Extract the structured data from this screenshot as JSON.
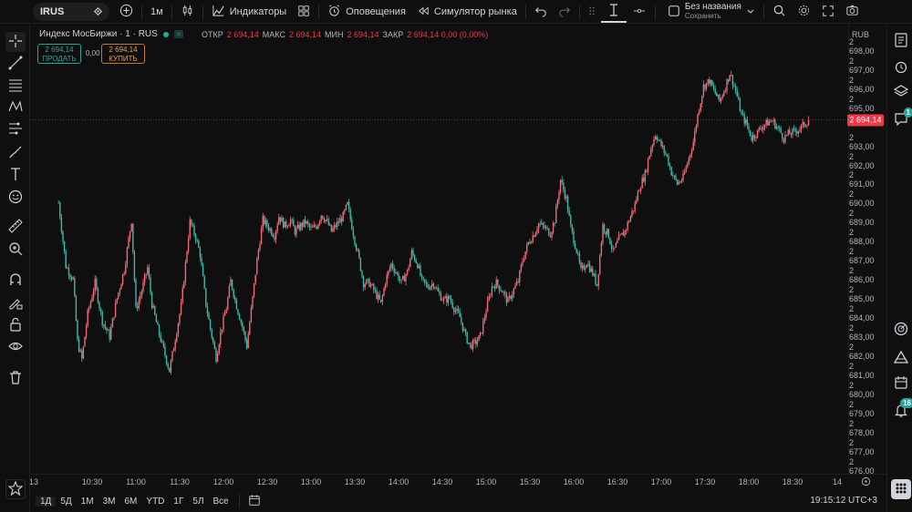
{
  "toolbar": {
    "symbol": "IRUS",
    "interval": "1м",
    "indicators": "Индикаторы",
    "alerts": "Оповещения",
    "replay": "Симулятор рынка",
    "layout_name": "Без названия",
    "layout_save": "Сохранить"
  },
  "legend": {
    "title": "Индекс МосБиржи · 1 · RUS",
    "ohlc": [
      {
        "k": "ОТКР",
        "v": "2 694,14"
      },
      {
        "k": "МАКС",
        "v": "2 694,14"
      },
      {
        "k": "МИН",
        "v": "2 694,14"
      },
      {
        "k": "ЗАКР",
        "v": "2 694,14 0,00 (0,00%)"
      }
    ],
    "sell_price": "2 694,14",
    "sell_label": "ПРОДАТЬ",
    "buy_price": "2 694,14",
    "buy_label": "КУПИТЬ",
    "spread": "0,00"
  },
  "price_axis": {
    "currency": "RUB",
    "last_price": "2 694,14",
    "ticks": [
      "2 698,00",
      "2 697,00",
      "2 696,00",
      "2 695,00",
      "2 693,00",
      "2 692,00",
      "2 691,00",
      "2 690,00",
      "2 689,00",
      "2 688,00",
      "2 687,00",
      "2 686,00",
      "2 685,00",
      "2 684,00",
      "2 683,00",
      "2 682,00",
      "2 681,00",
      "2 680,00",
      "2 679,00",
      "2 678,00",
      "2 677,00",
      "2 676,00"
    ]
  },
  "time_axis": {
    "ticks": [
      "13",
      "10:30",
      "11:00",
      "11:30",
      "12:00",
      "12:30",
      "13:00",
      "13:30",
      "14:00",
      "14:30",
      "15:00",
      "15:30",
      "16:00",
      "16:30",
      "17:00",
      "17:30",
      "18:00",
      "18:30",
      "14"
    ]
  },
  "bottom": {
    "ranges": [
      "1Д",
      "5Д",
      "1М",
      "3М",
      "6М",
      "YTD",
      "1Г",
      "5Л",
      "Все"
    ],
    "active_range": "1Д",
    "clock": "19:15:12 UTC+3"
  },
  "badges": {
    "chat": "1",
    "notifications": "16"
  },
  "colors": {
    "up": "#f06a78",
    "down": "#3fb8a8",
    "background": "#0f0f0f",
    "price_label": "#f23645"
  },
  "chart_data": {
    "type": "candlestick",
    "x_start": "10:07",
    "x_end": "18:53",
    "interval": "1m",
    "ylim": [
      2675.8,
      2698.8
    ],
    "last": 2694.14,
    "close_path": [
      [
        "10:07",
        2689.8
      ],
      [
        "10:12",
        2686.5
      ],
      [
        "10:17",
        2685.8
      ],
      [
        "10:20",
        2682.5
      ],
      [
        "10:23",
        2681.6
      ],
      [
        "10:27",
        2684.0
      ],
      [
        "10:32",
        2685.6
      ],
      [
        "10:37",
        2683.6
      ],
      [
        "10:42",
        2682.8
      ],
      [
        "10:47",
        2684.8
      ],
      [
        "10:52",
        2686.3
      ],
      [
        "10:57",
        2688.9
      ],
      [
        "11:00",
        2684.2
      ],
      [
        "11:04",
        2685.2
      ],
      [
        "11:08",
        2686.4
      ],
      [
        "11:11",
        2684.5
      ],
      [
        "11:15",
        2683.2
      ],
      [
        "11:19",
        2682.1
      ],
      [
        "11:23",
        2681.0
      ],
      [
        "11:27",
        2682.7
      ],
      [
        "11:31",
        2684.4
      ],
      [
        "11:34",
        2686.6
      ],
      [
        "11:37",
        2688.8
      ],
      [
        "11:41",
        2688.0
      ],
      [
        "11:44",
        2687.1
      ],
      [
        "11:48",
        2684.5
      ],
      [
        "11:51",
        2683.2
      ],
      [
        "11:55",
        2681.7
      ],
      [
        "11:58",
        2683.0
      ],
      [
        "12:02",
        2684.3
      ],
      [
        "12:05",
        2685.7
      ],
      [
        "12:09",
        2684.4
      ],
      [
        "12:13",
        2683.3
      ],
      [
        "12:16",
        2682.3
      ],
      [
        "12:20",
        2684.8
      ],
      [
        "12:23",
        2686.8
      ],
      [
        "12:27",
        2688.9
      ],
      [
        "12:31",
        2688.5
      ],
      [
        "12:35",
        2688.1
      ],
      [
        "12:38",
        2689.1
      ],
      [
        "12:42",
        2688.6
      ],
      [
        "12:46",
        2688.9
      ],
      [
        "12:49",
        2688.3
      ],
      [
        "12:53",
        2688.6
      ],
      [
        "12:56",
        2688.8
      ],
      [
        "13:00",
        2688.4
      ],
      [
        "13:04",
        2688.6
      ],
      [
        "13:07",
        2689.2
      ],
      [
        "13:11",
        2688.8
      ],
      [
        "13:14",
        2688.3
      ],
      [
        "13:18",
        2688.7
      ],
      [
        "13:22",
        2689.1
      ],
      [
        "13:25",
        2689.7
      ],
      [
        "13:29",
        2688.2
      ],
      [
        "13:33",
        2686.8
      ],
      [
        "13:36",
        2685.6
      ],
      [
        "13:40",
        2685.6
      ],
      [
        "13:44",
        2685.1
      ],
      [
        "13:48",
        2684.5
      ],
      [
        "13:51",
        2685.7
      ],
      [
        "13:55",
        2686.6
      ],
      [
        "13:58",
        2686.2
      ],
      [
        "14:02",
        2685.6
      ],
      [
        "14:06",
        2686.2
      ],
      [
        "14:09",
        2687.2
      ],
      [
        "14:13",
        2686.6
      ],
      [
        "14:16",
        2685.7
      ],
      [
        "14:20",
        2685.4
      ],
      [
        "14:24",
        2685.6
      ],
      [
        "14:27",
        2685.1
      ],
      [
        "14:31",
        2684.7
      ],
      [
        "14:35",
        2684.8
      ],
      [
        "14:38",
        2684.3
      ],
      [
        "14:42",
        2683.8
      ],
      [
        "14:46",
        2682.8
      ],
      [
        "14:49",
        2682.3
      ],
      [
        "14:53",
        2682.5
      ],
      [
        "14:56",
        2682.8
      ],
      [
        "15:00",
        2684.2
      ],
      [
        "15:04",
        2685.4
      ],
      [
        "15:07",
        2685.6
      ],
      [
        "15:11",
        2685.2
      ],
      [
        "15:15",
        2684.6
      ],
      [
        "15:18",
        2685.1
      ],
      [
        "15:22",
        2685.7
      ],
      [
        "15:25",
        2686.8
      ],
      [
        "15:29",
        2687.7
      ],
      [
        "15:33",
        2688.2
      ],
      [
        "15:36",
        2688.7
      ],
      [
        "15:40",
        2688.5
      ],
      [
        "15:44",
        2688.2
      ],
      [
        "15:47",
        2688.9
      ],
      [
        "15:51",
        2691.0
      ],
      [
        "15:55",
        2690.0
      ],
      [
        "15:58",
        2688.5
      ],
      [
        "16:02",
        2687.3
      ],
      [
        "16:05",
        2686.2
      ],
      [
        "16:09",
        2686.7
      ],
      [
        "16:13",
        2686.1
      ],
      [
        "16:16",
        2685.5
      ],
      [
        "16:20",
        2688.6
      ],
      [
        "16:24",
        2688.1
      ],
      [
        "16:27",
        2687.2
      ],
      [
        "16:31",
        2687.9
      ],
      [
        "16:35",
        2688.3
      ],
      [
        "16:38",
        2688.9
      ],
      [
        "16:42",
        2689.7
      ],
      [
        "16:45",
        2690.6
      ],
      [
        "16:49",
        2691.3
      ],
      [
        "16:53",
        2692.7
      ],
      [
        "16:56",
        2693.4
      ],
      [
        "17:00",
        2692.8
      ],
      [
        "17:04",
        2692.2
      ],
      [
        "17:07",
        2691.4
      ],
      [
        "17:11",
        2690.8
      ],
      [
        "17:15",
        2691.1
      ],
      [
        "17:18",
        2691.9
      ],
      [
        "17:22",
        2693.0
      ],
      [
        "17:25",
        2694.4
      ],
      [
        "17:29",
        2695.9
      ],
      [
        "17:33",
        2696.2
      ],
      [
        "17:36",
        2695.7
      ],
      [
        "17:40",
        2695.1
      ],
      [
        "17:44",
        2695.9
      ],
      [
        "17:47",
        2696.6
      ],
      [
        "17:51",
        2695.7
      ],
      [
        "17:55",
        2694.4
      ],
      [
        "17:58",
        2694.0
      ],
      [
        "18:02",
        2693.2
      ],
      [
        "18:06",
        2693.5
      ],
      [
        "18:09",
        2693.8
      ],
      [
        "18:13",
        2694.0
      ],
      [
        "18:16",
        2694.1
      ],
      [
        "18:20",
        2693.7
      ],
      [
        "18:24",
        2693.2
      ],
      [
        "18:27",
        2693.4
      ],
      [
        "18:31",
        2693.5
      ],
      [
        "18:35",
        2693.7
      ],
      [
        "18:38",
        2693.9
      ],
      [
        "18:41",
        2694.14
      ]
    ]
  }
}
